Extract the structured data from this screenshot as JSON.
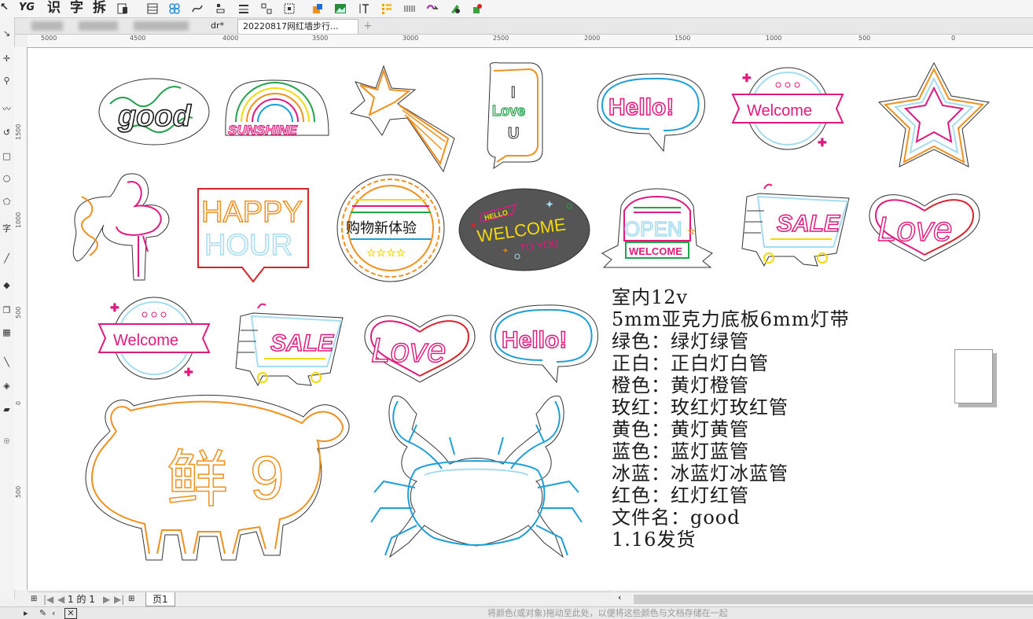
{
  "toolbar": {
    "yg_label": "YG",
    "shi_label": "识",
    "zi_label": "字",
    "chai_label": "拆"
  },
  "tabs": {
    "file1_label": "dr*",
    "file2_label": "20220817网红墙步行...",
    "add_label": "+"
  },
  "hruler": {
    "ticks": [
      "5000",
      "4500",
      "4000",
      "3500",
      "3000",
      "2500",
      "2000",
      "1500",
      "1000",
      "500",
      "0"
    ]
  },
  "vruler": {
    "ticks": [
      "1500",
      "1000",
      "500",
      "0",
      "500"
    ]
  },
  "canvas_art": {
    "good": "good",
    "sunshine": "SUNSHINE",
    "i_love_u": [
      "I",
      "Love",
      "U"
    ],
    "hello1": "Hello!",
    "welcome1": "Welcome",
    "happy": "HAPPY",
    "hour": "HOUR",
    "gouwu": "购物新体验",
    "hello_small": "HELLO",
    "welcome_dark": "WELCOME",
    "to_you": "TO YOU",
    "open": "OPEN",
    "welcome_open": "WELCOME",
    "sale1": "SALE",
    "love1": "Love",
    "welcome2": "Welcome",
    "sale2": "SALE",
    "love2": "Love",
    "hello2": "Hello!",
    "xian": "鲜",
    "nine": "9"
  },
  "info_lines": [
    "室内12v",
    "5mm亚克力底板6mm灯带",
    "绿色：绿灯绿管",
    "正白：正白灯白管",
    "橙色：黄灯橙管",
    "玫红：玫红灯玫红管",
    "黄色：黄灯黄管",
    "蓝色：蓝灯蓝管",
    "冰蓝：冰蓝灯冰蓝管",
    "红色：红灯红管",
    "文件名：good",
    "1.16发货"
  ],
  "pagenav": {
    "page_count": "1 的 1",
    "page_tab": "页1"
  },
  "status": {
    "hint": "将颜色(或对象)拖动至此处，以便将这些颜色与文档存储在一起"
  },
  "colors": {
    "pink": "#e0197d",
    "orange": "#f0901e",
    "blue": "#1e9fd8",
    "iceblue": "#a6dcf0",
    "green": "#22a24a",
    "yellow": "#f5d90a",
    "red": "#d8232a"
  }
}
